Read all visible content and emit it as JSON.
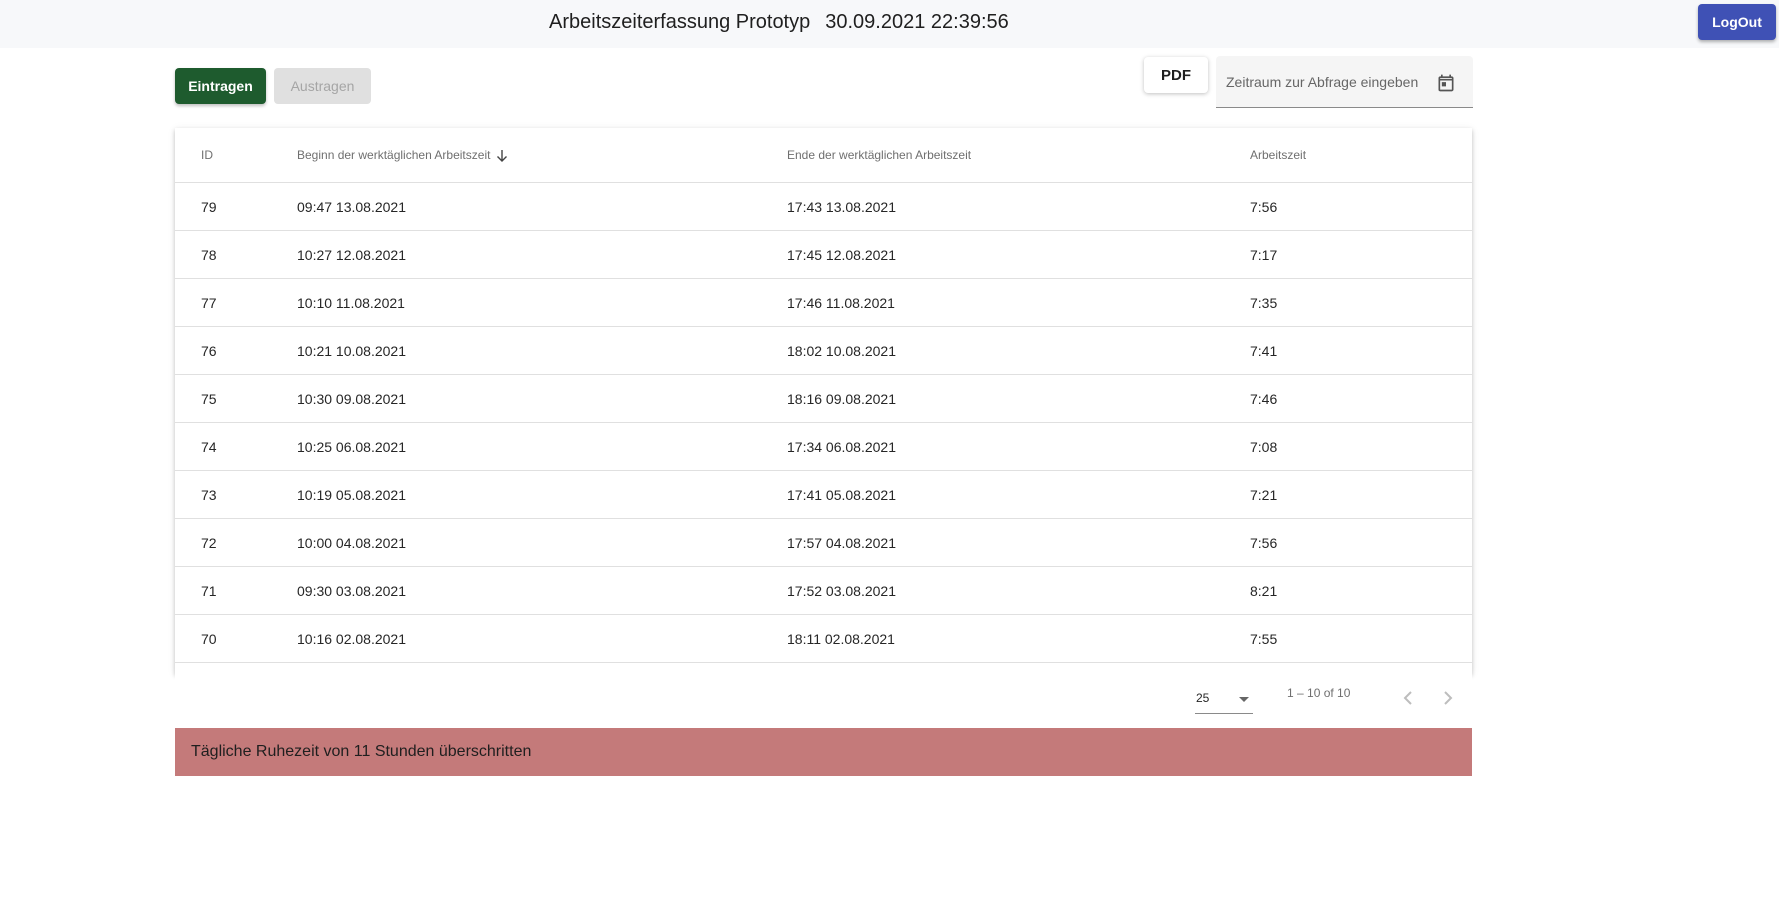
{
  "header": {
    "title": "Arbeitszeiterfassung Prototyp",
    "clock": "30.09.2021 22:39:56",
    "logout_label": "LogOut"
  },
  "toolbar": {
    "eintragen_label": "Eintragen",
    "austragen_label": "Austragen",
    "pdf_label": "PDF",
    "date_placeholder": "Zeitraum zur Abfrage eingeben"
  },
  "table": {
    "columns": [
      "ID",
      "Beginn der werktäglichen Arbeitszeit",
      "Ende der werktäglichen Arbeitszeit",
      "Arbeitszeit"
    ],
    "sort": {
      "column": "Beginn der werktäglichen Arbeitszeit",
      "direction": "descending"
    },
    "rows": [
      {
        "id": "79",
        "beginn": "09:47 13.08.2021",
        "ende": "17:43 13.08.2021",
        "arbeitszeit": "7:56"
      },
      {
        "id": "78",
        "beginn": "10:27 12.08.2021",
        "ende": "17:45 12.08.2021",
        "arbeitszeit": "7:17"
      },
      {
        "id": "77",
        "beginn": "10:10 11.08.2021",
        "ende": "17:46 11.08.2021",
        "arbeitszeit": "7:35"
      },
      {
        "id": "76",
        "beginn": "10:21 10.08.2021",
        "ende": "18:02 10.08.2021",
        "arbeitszeit": "7:41"
      },
      {
        "id": "75",
        "beginn": "10:30 09.08.2021",
        "ende": "18:16 09.08.2021",
        "arbeitszeit": "7:46"
      },
      {
        "id": "74",
        "beginn": "10:25 06.08.2021",
        "ende": "17:34 06.08.2021",
        "arbeitszeit": "7:08"
      },
      {
        "id": "73",
        "beginn": "10:19 05.08.2021",
        "ende": "17:41 05.08.2021",
        "arbeitszeit": "7:21"
      },
      {
        "id": "72",
        "beginn": "10:00 04.08.2021",
        "ende": "17:57 04.08.2021",
        "arbeitszeit": "7:56"
      },
      {
        "id": "71",
        "beginn": "09:30 03.08.2021",
        "ende": "17:52 03.08.2021",
        "arbeitszeit": "8:21"
      },
      {
        "id": "70",
        "beginn": "10:16 02.08.2021",
        "ende": "18:11 02.08.2021",
        "arbeitszeit": "7:55"
      }
    ]
  },
  "paginator": {
    "page_size": "25",
    "range_label": "1 – 10 of 10",
    "prev_icon": "chevron-left-icon",
    "next_icon": "chevron-right-icon"
  },
  "warning": {
    "text": "Tägliche Ruhezeit von 11 Stunden überschritten"
  },
  "colors": {
    "primary": "#3f51b5",
    "eintragen": "#1e5b2e",
    "warning_bg": "#c47a7a"
  }
}
